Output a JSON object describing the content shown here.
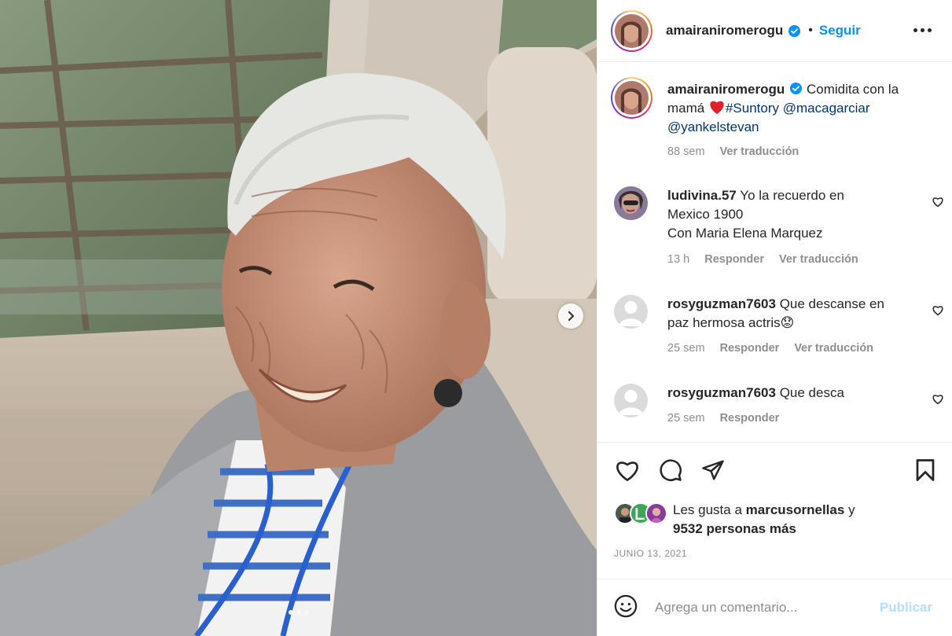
{
  "post": {
    "author": "amairaniromerogu",
    "follow_label": "Seguir",
    "separator": "•",
    "photo": {
      "slide_count": 3,
      "active_slide": 1
    },
    "caption": {
      "username": "amairaniromerogu",
      "text_start": "Comidita con la mamá",
      "hashtag": "#Suntory",
      "mention1": "@macagarciar",
      "mention2": "@yankelstevan",
      "age": "88 sem",
      "translate": "Ver traducción"
    },
    "comments": [
      {
        "username": "ludivina.57",
        "line1": "Yo la recuerdo en",
        "line2": "Mexico 1900",
        "line3": "Con Maria Elena Marquez",
        "age": "13 h",
        "reply": "Responder",
        "translate": "Ver traducción"
      },
      {
        "username": "rosyguzman7603",
        "line1": "Que descanse en",
        "line2": "paz hermosa actris",
        "emoji": "😟",
        "age": "25 sem",
        "reply": "Responder",
        "translate": "Ver traducción"
      },
      {
        "username": "rosyguzman7603",
        "line1": "Que desca",
        "age": "25 sem",
        "reply": "Responder"
      }
    ],
    "likes": {
      "prefix": "Les gusta a",
      "user": "marcusornellas",
      "conj": "y",
      "others": "9532 personas más"
    },
    "date": "JUNIO 13, 2021",
    "comment_box": {
      "placeholder": "Agrega un comentario...",
      "publish": "Publicar"
    }
  },
  "colors": {
    "accent": "#0095f6",
    "link": "#00376b",
    "muted": "#8e8e8e",
    "publish_disabled": "#b2dffc",
    "heart": "#ed4956"
  },
  "icons": [
    "verified-badge-icon",
    "more-options-icon",
    "like-icon",
    "comment-icon",
    "share-icon",
    "bookmark-icon",
    "emoji-icon",
    "chevron-right-icon",
    "heart-emoji-icon"
  ]
}
